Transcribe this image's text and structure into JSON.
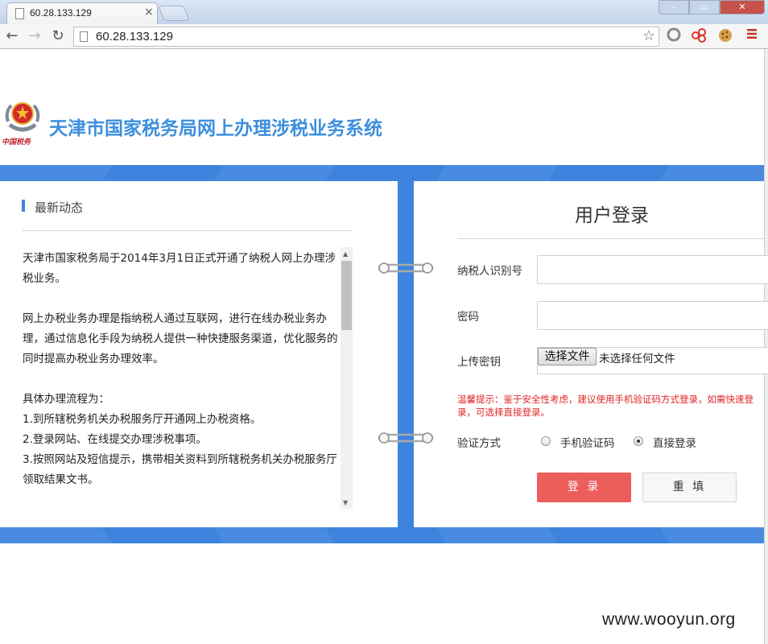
{
  "browser": {
    "tab_title": "60.28.133.129",
    "tab_close": "×",
    "url": "60.28.133.129",
    "back_glyph": "←",
    "forward_glyph": "→",
    "reload_glyph": "↻",
    "star_glyph": "☆",
    "icons": [
      "page-icon",
      "bookmark-star-icon",
      "extension-circle-icon",
      "extension-share-icon",
      "extension-cookie-icon",
      "menu-icon"
    ]
  },
  "header": {
    "site_title": "天津市国家税务局网上办理涉税业务系统",
    "emblem_caption": "中国税务"
  },
  "news": {
    "section_title": "最新动态",
    "paragraphs": [
      "天津市国家税务局于2014年3月1日正式开通了纳税人网上办理涉税业务。",
      "网上办税业务办理是指纳税人通过互联网，进行在线办税业务办理，通过信息化手段为纳税人提供一种快捷服务渠道，优化服务的同时提高办税业务办理效率。"
    ],
    "process_title": "具体办理流程为：",
    "steps": [
      "1.到所辖税务机关办税服务厅开通网上办税资格。",
      "2.登录网站、在线提交办理涉税事项。",
      "3.按照网站及短信提示，携带相关资料到所辖税务机关办税服务厅领取结果文书。"
    ]
  },
  "login": {
    "title": "用户登录",
    "taxpayer_id_label": "纳税人识别号",
    "taxpayer_id_value": "",
    "password_label": "密码",
    "password_value": "",
    "key_label": "上传密钥",
    "file_button": "选择文件",
    "file_status": "未选择任何文件",
    "tip": "温馨提示：鉴于安全性考虑，建议使用手机验证码方式登录，如需快速登录，可选择直接登录。",
    "verify_label": "验证方式",
    "verify_options": [
      "手机验证码",
      "直接登录"
    ],
    "verify_selected": "直接登录",
    "login_button": "登 录",
    "reset_button": "重 填"
  },
  "watermark": "www.wooyun.org",
  "colors": {
    "brand_blue": "#3e84de",
    "title_blue": "#3d8fdd",
    "login_red": "#ec5e5c",
    "tip_red": "#e02222"
  }
}
